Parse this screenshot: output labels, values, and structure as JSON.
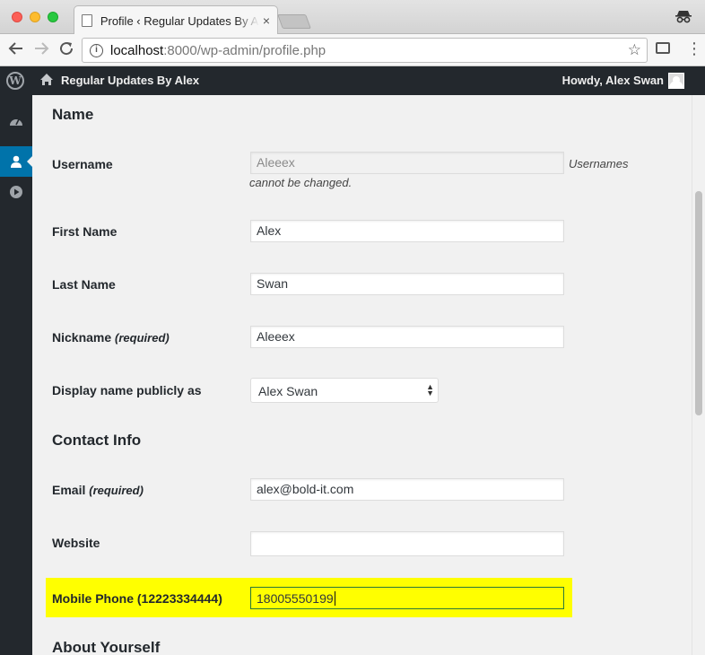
{
  "browser": {
    "tab_title": "Profile ‹ Regular Updates By Alex — WordPress",
    "tab_close": "×",
    "url_host": "localhost",
    "url_path": ":8000/wp-admin/profile.php",
    "icons": [
      "back-icon",
      "forward-icon",
      "reload-icon",
      "info-icon",
      "star-icon",
      "cast-icon",
      "menu-icon",
      "incognito-icon"
    ]
  },
  "adminbar": {
    "site_name": "Regular Updates By Alex",
    "howdy": "Howdy, Alex Swan",
    "accent": "#23282d"
  },
  "sidebar": {
    "items": [
      {
        "icon": "dashboard-icon"
      },
      {
        "icon": "user-icon",
        "active": true
      },
      {
        "icon": "media-play-icon"
      }
    ],
    "active_color": "#0073aa"
  },
  "form": {
    "name_heading": "Name",
    "username_label": "Username",
    "username_value": "Aleeex",
    "username_desc_1": "Usernames",
    "username_desc_2": "cannot be changed.",
    "first_name_label": "First Name",
    "first_name_value": "Alex",
    "last_name_label": "Last Name",
    "last_name_value": "Swan",
    "nickname_label": "Nickname",
    "nickname_required": "(required)",
    "nickname_value": "Aleeex",
    "display_name_label": "Display name publicly as",
    "display_name_value": "Alex Swan",
    "contact_heading": "Contact Info",
    "email_label": "Email",
    "email_required": "(required)",
    "email_value": "alex@bold-it.com",
    "website_label": "Website",
    "website_value": "",
    "mobile_label": "Mobile Phone (12223334444)",
    "mobile_value": "18005550199",
    "about_heading": "About Yourself",
    "highlight_color": "#ffff00"
  }
}
